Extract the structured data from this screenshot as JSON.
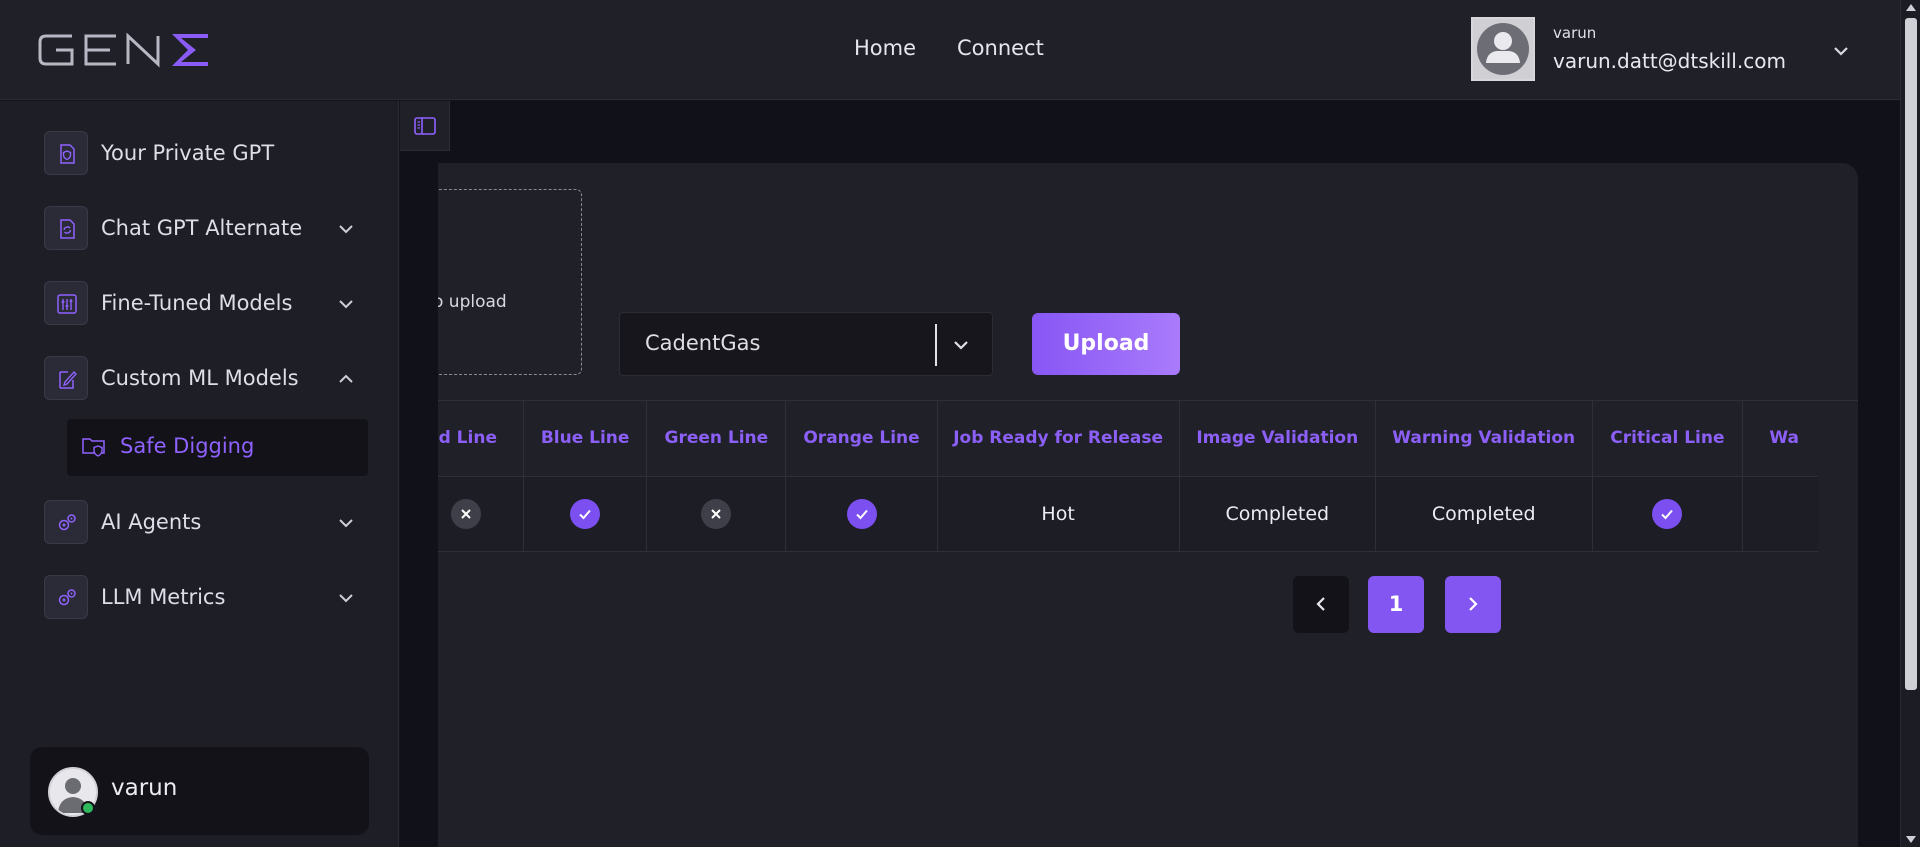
{
  "header": {
    "logo_text": "GENΣ",
    "nav": [
      "Home",
      "Connect"
    ],
    "user": {
      "name": "varun",
      "email": "varun.datt@dtskill.com"
    }
  },
  "sidebar": {
    "items": [
      {
        "label": "Your Private GPT",
        "icon": "shield-document-icon"
      },
      {
        "label": "Chat GPT Alternate",
        "icon": "refresh-document-icon",
        "expanded": false
      },
      {
        "label": "Fine-Tuned Models",
        "icon": "sliders-icon",
        "expanded": false
      },
      {
        "label": "Custom ML Models",
        "icon": "edit-document-icon",
        "expanded": true
      },
      {
        "label": "AI Agents",
        "icon": "gears-icon",
        "expanded": false
      },
      {
        "label": "LLM Metrics",
        "icon": "gears-icon",
        "expanded": false
      }
    ],
    "active_subitem": {
      "label": "Safe Digging",
      "icon": "shield-folder-icon"
    },
    "user": {
      "name": "varun",
      "status": "online"
    }
  },
  "upload": {
    "dropzone_text": "o upload",
    "select_value": "CadentGas",
    "button_label": "Upload"
  },
  "table": {
    "columns": [
      "ed Line",
      "Blue Line",
      "Green Line",
      "Orange Line",
      "Job Ready for Release",
      "Image Validation",
      "Warning Validation",
      "Critical Line",
      "Wa"
    ],
    "rows": [
      {
        "ed_line": false,
        "blue_line": true,
        "green_line": false,
        "orange_line": true,
        "job_ready": "Hot",
        "image_validation": "Completed",
        "warning_validation": "Completed",
        "critical_line": true,
        "wa": ""
      }
    ]
  },
  "pagination": {
    "current_page": "1"
  },
  "colors": {
    "accent": "#8c5ff6",
    "background": "#14141c",
    "panel": "#1f2028"
  }
}
